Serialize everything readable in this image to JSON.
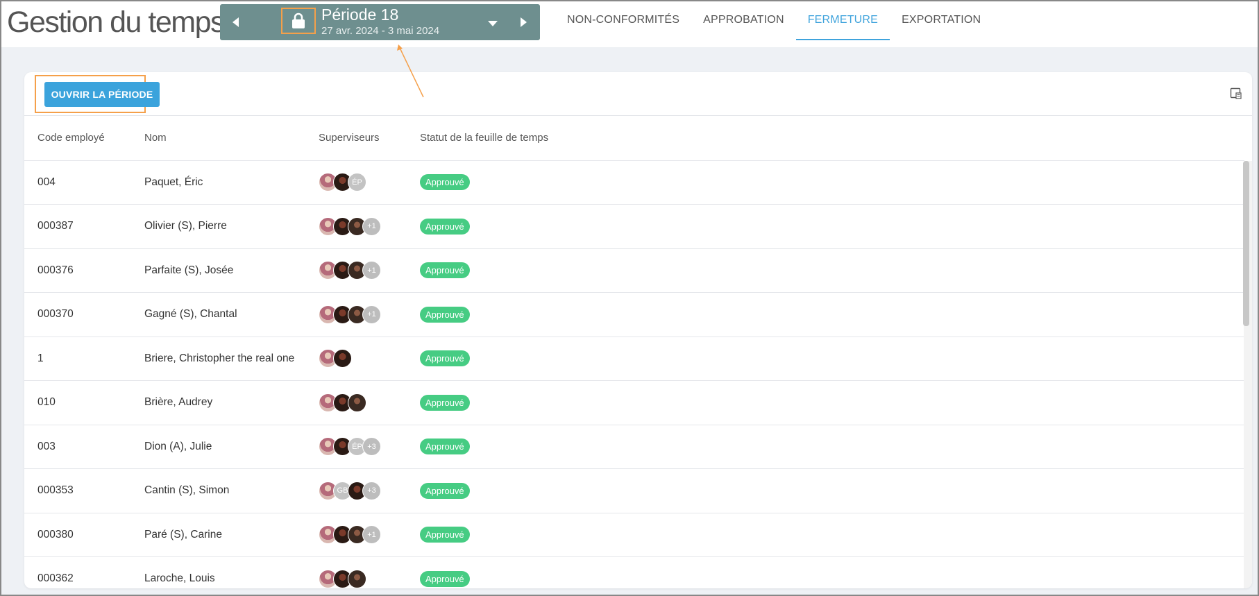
{
  "header": {
    "app_title": "Gestion du temps",
    "period": {
      "title": "Période 18",
      "dates": "27 avr. 2024 - 3 mai 2024",
      "icons": {
        "prev": "caret-left-icon",
        "lock": "lock-icon",
        "dropdown": "caret-down-icon",
        "next": "caret-right-icon"
      }
    },
    "tabs": [
      {
        "label": "NON-CONFORMITÉS",
        "active": false
      },
      {
        "label": "APPROBATION",
        "active": false
      },
      {
        "label": "FERMETURE",
        "active": true
      },
      {
        "label": "EXPORTATION",
        "active": false
      }
    ]
  },
  "toolbar": {
    "open_period_label": "OUVRIR LA PÉRIODE",
    "columns_icon": "column-settings-icon"
  },
  "table": {
    "headers": [
      "Code employé",
      "Nom",
      "Superviseurs",
      "Statut de la feuille de temps"
    ],
    "rows": [
      {
        "code": "004",
        "name": "Paquet, Éric",
        "avatars": [
          "photo1",
          "photo2",
          "ÉP"
        ],
        "status": "Approuvé"
      },
      {
        "code": "000387",
        "name": "Olivier (S), Pierre",
        "avatars": [
          "photo1",
          "photo2",
          "photo3",
          "+1"
        ],
        "status": "Approuvé"
      },
      {
        "code": "000376",
        "name": "Parfaite (S), Josée",
        "avatars": [
          "photo1",
          "photo2",
          "photo3",
          "+1"
        ],
        "status": "Approuvé"
      },
      {
        "code": "000370",
        "name": "Gagné (S), Chantal",
        "avatars": [
          "photo1",
          "photo2",
          "photo3",
          "+1"
        ],
        "status": "Approuvé"
      },
      {
        "code": "1",
        "name": "Briere, Christopher the real one",
        "avatars": [
          "photo1",
          "photo2"
        ],
        "status": "Approuvé"
      },
      {
        "code": "010",
        "name": "Brière, Audrey",
        "avatars": [
          "photo1",
          "photo2",
          "photo3"
        ],
        "status": "Approuvé"
      },
      {
        "code": "003",
        "name": "Dion (A), Julie",
        "avatars": [
          "photo1",
          "photo2",
          "ÉP",
          "+3"
        ],
        "status": "Approuvé"
      },
      {
        "code": "000353",
        "name": "Cantin (S), Simon",
        "avatars": [
          "photo1",
          "GB",
          "photo2",
          "+3"
        ],
        "status": "Approuvé"
      },
      {
        "code": "000380",
        "name": "Paré (S), Carine",
        "avatars": [
          "photo1",
          "photo2",
          "photo3",
          "+1"
        ],
        "status": "Approuvé"
      },
      {
        "code": "000362",
        "name": "Laroche, Louis",
        "avatars": [
          "photo1",
          "photo2",
          "photo3"
        ],
        "status": "Approuvé"
      }
    ]
  },
  "colors": {
    "accent": "#3fa3dc",
    "period_bg": "#6e8f8f",
    "status_approved": "#46cc83",
    "highlight_outline": "#f5a04a"
  }
}
